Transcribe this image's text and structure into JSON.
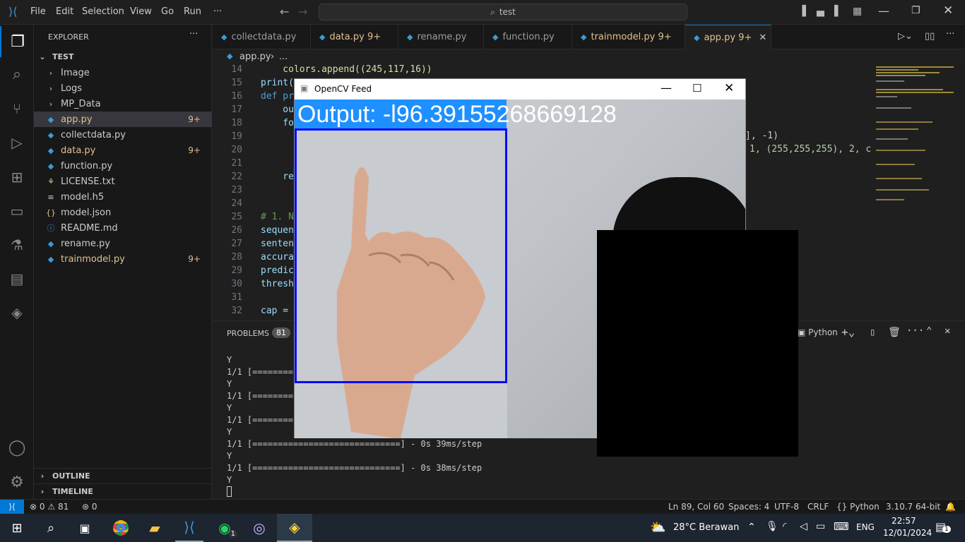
{
  "menu": [
    "File",
    "Edit",
    "Selection",
    "View",
    "Go",
    "Run",
    "···"
  ],
  "search": {
    "text": "test"
  },
  "explorer": {
    "title": "EXPLORER",
    "root": "TEST",
    "folders": [
      "Image",
      "Logs",
      "MP_Data"
    ],
    "files": [
      {
        "name": "app.py",
        "badge": "9+",
        "color": "#e2c08d",
        "icon": "python-icon"
      },
      {
        "name": "collectdata.py",
        "badge": "",
        "color": "#cccccc",
        "icon": "python-icon"
      },
      {
        "name": "data.py",
        "badge": "9+",
        "color": "#e2c08d",
        "icon": "python-icon"
      },
      {
        "name": "function.py",
        "badge": "",
        "color": "#cccccc",
        "icon": "python-icon"
      },
      {
        "name": "LICENSE.txt",
        "badge": "",
        "color": "#cccccc",
        "icon": "license-icon"
      },
      {
        "name": "model.h5",
        "badge": "",
        "color": "#cccccc",
        "icon": "file-icon"
      },
      {
        "name": "model.json",
        "badge": "",
        "color": "#cccccc",
        "icon": "json-icon"
      },
      {
        "name": "README.md",
        "badge": "",
        "color": "#cccccc",
        "icon": "info-icon"
      },
      {
        "name": "rename.py",
        "badge": "",
        "color": "#cccccc",
        "icon": "python-icon"
      },
      {
        "name": "trainmodel.py",
        "badge": "9+",
        "color": "#e2c08d",
        "icon": "python-icon"
      }
    ],
    "outline": "OUTLINE",
    "timeline": "TIMELINE"
  },
  "tabs": [
    {
      "label": "collectdata.py",
      "badge": ""
    },
    {
      "label": "data.py",
      "badge": "9+"
    },
    {
      "label": "rename.py",
      "badge": ""
    },
    {
      "label": "function.py",
      "badge": ""
    },
    {
      "label": "trainmodel.py",
      "badge": "9+"
    },
    {
      "label": "app.py",
      "badge": "9+"
    }
  ],
  "breadcrumb": {
    "file": "app.py",
    "rest": "..."
  },
  "editor": {
    "lines": [
      {
        "n": "14",
        "code": "    colors.append((245,117,16))"
      },
      {
        "n": "15",
        "code": "print("
      },
      {
        "n": "16",
        "code": "def pr"
      },
      {
        "n": "17",
        "code": "    ou"
      },
      {
        "n": "18",
        "code": "    fo"
      },
      {
        "n": "19",
        "code": "      "
      },
      {
        "n": "20",
        "code": "      "
      },
      {
        "n": "21",
        "code": ""
      },
      {
        "n": "22",
        "code": "    re"
      },
      {
        "n": "23",
        "code": ""
      },
      {
        "n": "24",
        "code": ""
      },
      {
        "n": "25",
        "code": "# 1. N"
      },
      {
        "n": "26",
        "code": "sequen"
      },
      {
        "n": "27",
        "code": "senten"
      },
      {
        "n": "28",
        "code": "accura"
      },
      {
        "n": "29",
        "code": "predic"
      },
      {
        "n": "30",
        "code": "thresh"
      },
      {
        "n": "31",
        "code": ""
      },
      {
        "n": "32",
        "code": "cap = "
      }
    ],
    "right19": "], -1)",
    "right20": "1, (255,255,255), 2, c"
  },
  "panel": {
    "problems": "PROBLEMS",
    "count": "81",
    "terminal_kind": "Python",
    "lines": [
      "Y",
      "1/1 [========",
      "Y",
      "1/1 [========",
      "Y",
      "1/1 [========",
      "Y",
      "1/1 [=============================] - 0s 39ms/step",
      "Y",
      "1/1 [=============================] - 0s 38ms/step",
      "Y"
    ]
  },
  "status": {
    "errors": "0",
    "warnings": "81",
    "ports": "0",
    "position": "Ln 89, Col 60",
    "spaces": "Spaces: 4",
    "encoding": "UTF-8",
    "eol": "CRLF",
    "lang": "Python",
    "interpreter": "3.10.7 64-bit"
  },
  "cv": {
    "title": "OpenCV Feed",
    "output": "Output: -l96.39155268669128"
  },
  "taskbar": {
    "weather": "28°C  Berawan",
    "lang": "ENG",
    "time": "22:57",
    "date": "12/01/2024",
    "notif": "1",
    "wa_badge": "1"
  }
}
